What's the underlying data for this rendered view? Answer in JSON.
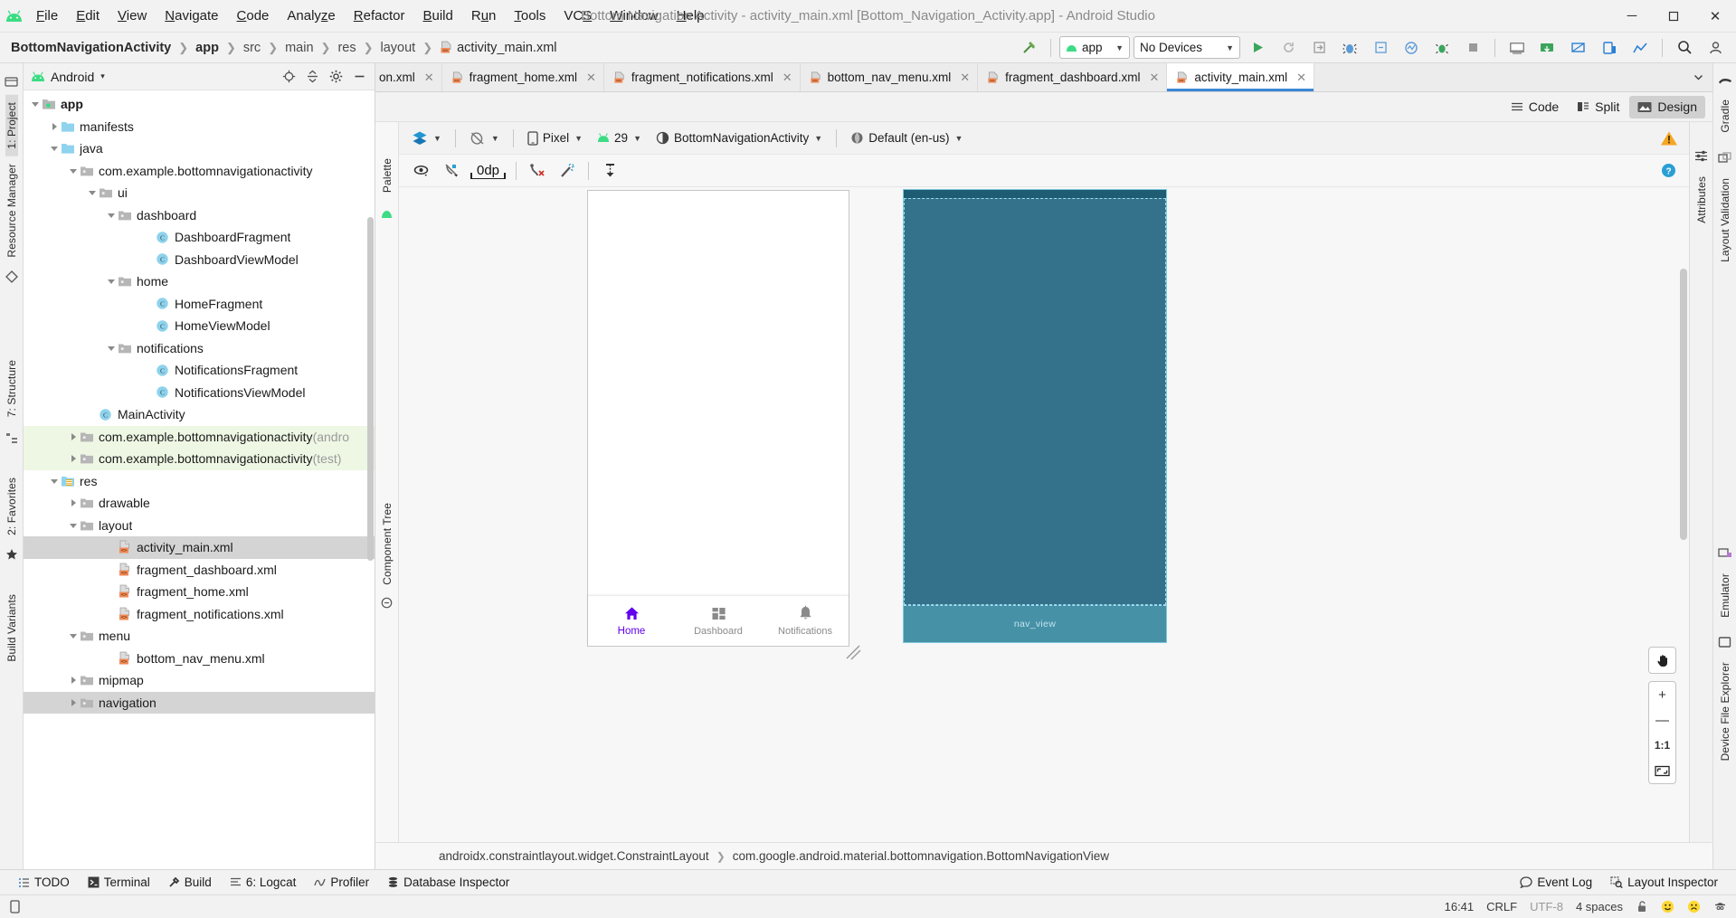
{
  "window": {
    "title": "Bottom Navigation Activity - activity_main.xml [Bottom_Navigation_Activity.app] - Android Studio",
    "minimize": "─",
    "maximize": "❐",
    "close": "✕"
  },
  "menubar": [
    {
      "label": "File",
      "mnemonic": "F"
    },
    {
      "label": "Edit",
      "mnemonic": "E"
    },
    {
      "label": "View",
      "mnemonic": "V"
    },
    {
      "label": "Navigate",
      "mnemonic": "N"
    },
    {
      "label": "Code",
      "mnemonic": "C"
    },
    {
      "label": "Analyze",
      "mnemonic": "z"
    },
    {
      "label": "Refactor",
      "mnemonic": "R"
    },
    {
      "label": "Build",
      "mnemonic": "B"
    },
    {
      "label": "Run",
      "mnemonic": "u"
    },
    {
      "label": "Tools",
      "mnemonic": "T"
    },
    {
      "label": "VCS",
      "mnemonic": "S"
    },
    {
      "label": "Window",
      "mnemonic": "W"
    },
    {
      "label": "Help",
      "mnemonic": "H"
    }
  ],
  "breadcrumb": [
    {
      "label": "BottomNavigationActivity",
      "style": "bold"
    },
    {
      "label": "app",
      "style": "bold"
    },
    {
      "label": "src",
      "style": "grey"
    },
    {
      "label": "main",
      "style": "grey"
    },
    {
      "label": "res",
      "style": "grey"
    },
    {
      "label": "layout",
      "style": "grey"
    },
    {
      "label": "activity_main.xml",
      "style": "file"
    }
  ],
  "run_toolbar": {
    "module": "app",
    "device": "No Devices",
    "run_tooltip": "Run",
    "icons": [
      "hammer-icon",
      "run-icon",
      "rerun-icon",
      "apply-changes-icon",
      "debug-icon",
      "apply-code-changes-icon",
      "profile-icon",
      "attach-debugger-icon",
      "stop-icon",
      "avd-manager-icon",
      "sdk-manager-icon",
      "layout-inspector-icon",
      "device-manager-icon",
      "search-icon",
      "account-icon"
    ]
  },
  "left_rail": [
    {
      "label": "1: Project",
      "active": true
    },
    {
      "label": "Resource Manager",
      "active": false
    },
    {
      "label": "7: Structure",
      "active": false
    },
    {
      "label": "2: Favorites",
      "active": false
    },
    {
      "label": "Build Variants",
      "active": false
    }
  ],
  "project_panel": {
    "title": "Android",
    "caret": "▾",
    "tools": [
      "locate-icon",
      "collapse-all-icon",
      "settings-icon",
      "hide-icon"
    ],
    "tree": [
      {
        "indent": 0,
        "twisty": "open",
        "icon": "module-folder",
        "label": "app",
        "bold": true,
        "suffix": "",
        "state": ""
      },
      {
        "indent": 1,
        "twisty": "closed",
        "icon": "folder-blue",
        "label": "manifests",
        "bold": false,
        "suffix": "",
        "state": ""
      },
      {
        "indent": 1,
        "twisty": "open",
        "icon": "folder-blue",
        "label": "java",
        "bold": false,
        "suffix": "",
        "state": ""
      },
      {
        "indent": 2,
        "twisty": "open",
        "icon": "package",
        "label": "com.example.bottomnavigationactivity",
        "bold": false,
        "suffix": "",
        "state": ""
      },
      {
        "indent": 3,
        "twisty": "open",
        "icon": "package",
        "label": "ui",
        "bold": false,
        "suffix": "",
        "state": ""
      },
      {
        "indent": 4,
        "twisty": "open",
        "icon": "package",
        "label": "dashboard",
        "bold": false,
        "suffix": "",
        "state": ""
      },
      {
        "indent": 6,
        "twisty": "none",
        "icon": "class",
        "label": "DashboardFragment",
        "bold": false,
        "suffix": "",
        "state": ""
      },
      {
        "indent": 6,
        "twisty": "none",
        "icon": "class",
        "label": "DashboardViewModel",
        "bold": false,
        "suffix": "",
        "state": ""
      },
      {
        "indent": 4,
        "twisty": "open",
        "icon": "package",
        "label": "home",
        "bold": false,
        "suffix": "",
        "state": ""
      },
      {
        "indent": 6,
        "twisty": "none",
        "icon": "class",
        "label": "HomeFragment",
        "bold": false,
        "suffix": "",
        "state": ""
      },
      {
        "indent": 6,
        "twisty": "none",
        "icon": "class",
        "label": "HomeViewModel",
        "bold": false,
        "suffix": "",
        "state": ""
      },
      {
        "indent": 4,
        "twisty": "open",
        "icon": "package",
        "label": "notifications",
        "bold": false,
        "suffix": "",
        "state": ""
      },
      {
        "indent": 6,
        "twisty": "none",
        "icon": "class",
        "label": "NotificationsFragment",
        "bold": false,
        "suffix": "",
        "state": ""
      },
      {
        "indent": 6,
        "twisty": "none",
        "icon": "class",
        "label": "NotificationsViewModel",
        "bold": false,
        "suffix": "",
        "state": ""
      },
      {
        "indent": 3,
        "twisty": "none",
        "icon": "class",
        "label": "MainActivity",
        "bold": false,
        "suffix": "",
        "state": ""
      },
      {
        "indent": 2,
        "twisty": "closed",
        "icon": "package",
        "label": "com.example.bottomnavigationactivity",
        "bold": false,
        "suffix": " (andro",
        "state": "green"
      },
      {
        "indent": 2,
        "twisty": "closed",
        "icon": "package",
        "label": "com.example.bottomnavigationactivity",
        "bold": false,
        "suffix": " (test)",
        "state": "green"
      },
      {
        "indent": 1,
        "twisty": "open",
        "icon": "res-folder",
        "label": "res",
        "bold": false,
        "suffix": "",
        "state": ""
      },
      {
        "indent": 2,
        "twisty": "closed",
        "icon": "package",
        "label": "drawable",
        "bold": false,
        "suffix": "",
        "state": ""
      },
      {
        "indent": 2,
        "twisty": "open",
        "icon": "package",
        "label": "layout",
        "bold": false,
        "suffix": "",
        "state": ""
      },
      {
        "indent": 4,
        "twisty": "none",
        "icon": "xml-file",
        "label": "activity_main.xml",
        "bold": false,
        "suffix": "",
        "state": "sel"
      },
      {
        "indent": 4,
        "twisty": "none",
        "icon": "xml-file",
        "label": "fragment_dashboard.xml",
        "bold": false,
        "suffix": "",
        "state": ""
      },
      {
        "indent": 4,
        "twisty": "none",
        "icon": "xml-file",
        "label": "fragment_home.xml",
        "bold": false,
        "suffix": "",
        "state": ""
      },
      {
        "indent": 4,
        "twisty": "none",
        "icon": "xml-file",
        "label": "fragment_notifications.xml",
        "bold": false,
        "suffix": "",
        "state": ""
      },
      {
        "indent": 2,
        "twisty": "open",
        "icon": "package",
        "label": "menu",
        "bold": false,
        "suffix": "",
        "state": ""
      },
      {
        "indent": 4,
        "twisty": "none",
        "icon": "xml-file",
        "label": "bottom_nav_menu.xml",
        "bold": false,
        "suffix": "",
        "state": ""
      },
      {
        "indent": 2,
        "twisty": "closed",
        "icon": "package",
        "label": "mipmap",
        "bold": false,
        "suffix": "",
        "state": ""
      },
      {
        "indent": 2,
        "twisty": "closed",
        "icon": "package",
        "label": "navigation",
        "bold": false,
        "suffix": "",
        "state": "sel"
      }
    ]
  },
  "editor_tabs": [
    {
      "label": "on.xml",
      "active": false,
      "clipped": true
    },
    {
      "label": "fragment_home.xml",
      "active": false,
      "clipped": false
    },
    {
      "label": "fragment_notifications.xml",
      "active": false,
      "clipped": false
    },
    {
      "label": "bottom_nav_menu.xml",
      "active": false,
      "clipped": false
    },
    {
      "label": "fragment_dashboard.xml",
      "active": false,
      "clipped": false
    },
    {
      "label": "activity_main.xml",
      "active": true,
      "clipped": false
    }
  ],
  "editor_modes": [
    {
      "label": "Code",
      "active": false,
      "icon": "code-icon"
    },
    {
      "label": "Split",
      "active": false,
      "icon": "split-icon"
    },
    {
      "label": "Design",
      "active": true,
      "icon": "design-icon"
    }
  ],
  "design_toolbar": {
    "surface_icon": "design-surface-icon",
    "blueprint_icon": "blueprint-mode-icon",
    "device": "Pixel",
    "api": "29",
    "theme": "BottomNavigationActivity",
    "locale": "Default (en-us)",
    "warning_icon": "warning-icon",
    "help_icon": "help-icon"
  },
  "design_toolbar2": {
    "view_options_icon": "eye-icon",
    "autoconnect_icon": "autoconnect-off-icon",
    "default_margin": "0dp",
    "clear_constraints_icon": "clear-constraints-icon",
    "infer_constraints_icon": "magic-wand-icon",
    "guidelines_icon": "guidelines-icon"
  },
  "preview": {
    "bottom_nav_items": [
      {
        "label": "Home",
        "icon": "home-icon",
        "active": true
      },
      {
        "label": "Dashboard",
        "icon": "dashboard-icon",
        "active": false
      },
      {
        "label": "Notifications",
        "icon": "bell-icon",
        "active": false
      }
    ],
    "blueprint_label": "nav_view",
    "accent_color": "#6200ee",
    "blueprint_bg": "#33728a",
    "blueprint_nav_bg": "#4791a6",
    "blueprint_status_bg": "#1d5c73",
    "blueprint_outline": "#9fdcee"
  },
  "zoom_controls": {
    "pan": "pan-icon",
    "zoom_in": "+",
    "zoom_out": "—",
    "actual_size": "1:1",
    "zoom_to_fit": "fit-icon"
  },
  "hierarchy": [
    "androidx.constraintlayout.widget.ConstraintLayout",
    "com.google.android.material.bottomnavigation.BottomNavigationView"
  ],
  "component_tree_rail": "Component Tree",
  "palette_rail": "Palette",
  "right_panel_rail": [
    "Attributes"
  ],
  "right_outer_rail": [
    "Gradle",
    "Layout Validation",
    "Emulator",
    "Device File Explorer"
  ],
  "tool_window_bar": {
    "left": [
      {
        "label": "TODO",
        "icon": "todo-icon"
      },
      {
        "label": "Terminal",
        "icon": "terminal-icon"
      },
      {
        "label": "Build",
        "icon": "build-icon"
      },
      {
        "label": "6: Logcat",
        "icon": "logcat-icon"
      },
      {
        "label": "Profiler",
        "icon": "profiler-icon"
      },
      {
        "label": "Database Inspector",
        "icon": "database-icon"
      }
    ],
    "right": [
      {
        "label": "Event Log",
        "icon": "event-log-icon"
      },
      {
        "label": "Layout Inspector",
        "icon": "layout-inspector-icon"
      }
    ]
  },
  "statusbar": {
    "left_icon": "device-icon",
    "time": "16:41",
    "line_ending": "CRLF",
    "encoding": "UTF-8",
    "indent": "4 spaces",
    "lock_icon": "unlock-icon",
    "happy_icon": "🙂",
    "sad_icon": "🙁",
    "hat_icon": "detective-icon"
  }
}
